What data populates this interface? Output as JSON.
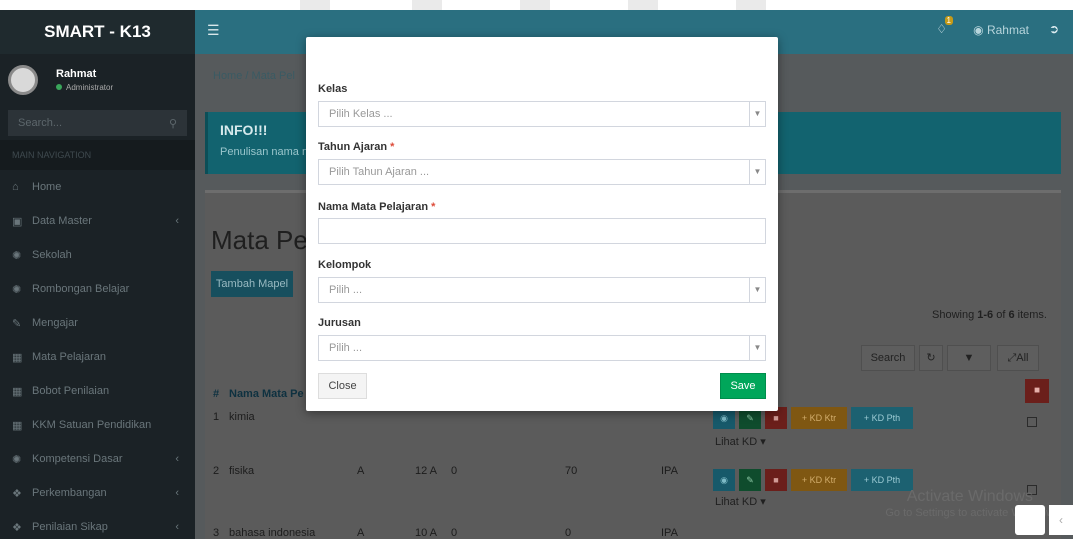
{
  "app": {
    "brand": "SMART - K13"
  },
  "user": {
    "name": "Rahmat",
    "role": "Administrator"
  },
  "sidebar": {
    "search_placeholder": "Search...",
    "nav_header": "MAIN NAVIGATION",
    "items": [
      {
        "label": "Home",
        "icon": "home-icon"
      },
      {
        "label": "Data Master",
        "icon": "book-icon",
        "has_children": true
      },
      {
        "label": "Sekolah",
        "icon": "gear-icon"
      },
      {
        "label": "Rombongan Belajar",
        "icon": "gear-icon"
      },
      {
        "label": "Mengajar",
        "icon": "edit-icon"
      },
      {
        "label": "Mata Pelajaran",
        "icon": "table-icon"
      },
      {
        "label": "Bobot Penilaian",
        "icon": "table-icon"
      },
      {
        "label": "KKM Satuan Pendidikan",
        "icon": "table-icon"
      },
      {
        "label": "Kompetensi Dasar",
        "icon": "gear-icon",
        "has_children": true
      },
      {
        "label": "Perkembangan",
        "icon": "stats-icon",
        "has_children": true
      },
      {
        "label": "Penilaian Sikap",
        "icon": "stats-icon",
        "has_children": true
      }
    ]
  },
  "header": {
    "notification_count": "1",
    "user_name": "Rahmat"
  },
  "breadcrumb": {
    "home": "Home",
    "separator": "/",
    "current": "Mata Pel"
  },
  "info": {
    "title": "INFO!!!",
    "text": "Penulisan nama n"
  },
  "panel": {
    "title": "Mata Pel",
    "add_button": "Tambah Mapel",
    "showing_prefix": "Showing ",
    "showing_range": "1-6",
    "showing_mid": " of ",
    "showing_total": "6",
    "showing_suffix": " items.",
    "toolbar": {
      "search": "Search",
      "all": "All"
    }
  },
  "table": {
    "headers": {
      "num": "#",
      "name": "Nama Mata Pe"
    },
    "rows": [
      {
        "num": "1",
        "name": "kimia",
        "kelompok": "",
        "kelas": "",
        "nilai": "",
        "kkm": "",
        "jurusan": ""
      },
      {
        "num": "2",
        "name": "fisika",
        "kelompok": "A",
        "kelas": "12 A",
        "nilai": "0",
        "kkm": "70",
        "jurusan": "IPA"
      },
      {
        "num": "3",
        "name": "bahasa indonesia",
        "kelompok": "A",
        "kelas": "10 A",
        "nilai": "0",
        "kkm": "0",
        "jurusan": "IPA"
      }
    ],
    "actions": {
      "ktr": "+ KD Ktr",
      "pth": "+ KD Pth",
      "lihat": "Lihat KD ▾"
    }
  },
  "modal": {
    "kelas": {
      "label": "Kelas",
      "placeholder": "Pilih Kelas ..."
    },
    "tahun": {
      "label": "Tahun Ajaran",
      "required": "*",
      "placeholder": "Pilih Tahun Ajaran ..."
    },
    "nama": {
      "label": "Nama Mata Pelajaran",
      "required": "*",
      "value": ""
    },
    "kelompok": {
      "label": "Kelompok",
      "placeholder": "Pilih ..."
    },
    "jurusan": {
      "label": "Jurusan",
      "placeholder": "Pilih ..."
    },
    "close": "Close",
    "save": "Save"
  },
  "watermark": {
    "line1": "Activate Windows",
    "line2": "Go to Settings to activate Windows."
  },
  "colors": {
    "save_green": "#00a65a",
    "header_teal": "#2a6f80",
    "required_red": "#dd4b39"
  }
}
